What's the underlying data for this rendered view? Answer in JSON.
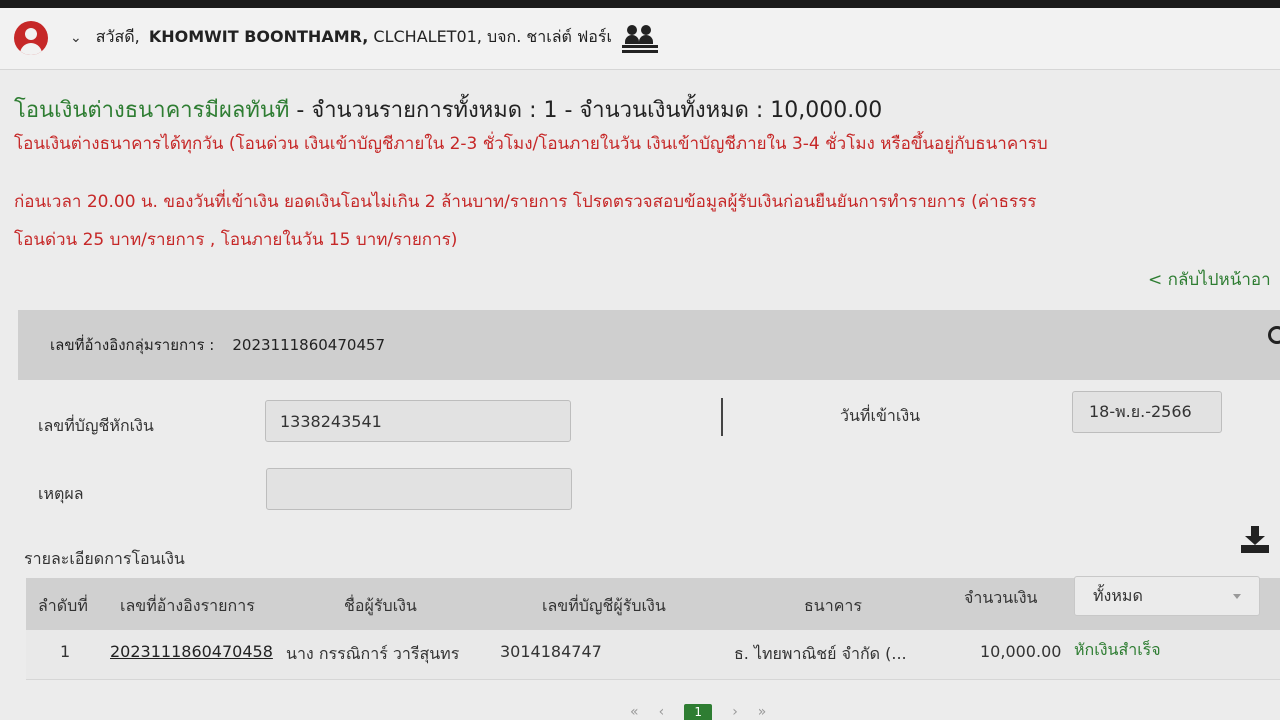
{
  "header": {
    "greeting_prefix": "สวัสดี,",
    "user_name": "KHOMWIT BOONTHAMR,",
    "company": "CLCHALET01, บจก. ชาเล่ต์ ฟอร์เ"
  },
  "page": {
    "title_main": "โอนเงินต่างธนาคารมีผลทันที",
    "title_rest": " - จำนวนรายการทั้งหมด : 1 - จำนวนเงินทั้งหมด : 10,000.00",
    "notice_line1": "โอนเงินต่างธนาคารได้ทุกวัน (โอนด่วน เงินเข้าบัญชีภายใน 2-3 ชั่วโมง/โอนภายในวัน เงินเข้าบัญชีภายใน 3-4 ชั่วโมง หรือขึ้นอยู่กับธนาคารบ",
    "notice_line2": "ก่อนเวลา 20.00 น. ของวันที่เข้าเงิน ยอดเงินโอนไม่เกิน 2 ล้านบาท/รายการ โปรดตรวจสอบข้อมูลผู้รับเงินก่อนยืนยันการทำรายการ (ค่าธรรร",
    "notice_line3": "โอนด่วน 25 บาท/รายการ , โอนภายในวัน 15 บาท/รายการ)",
    "back_label": "< กลับไปหน้าอา"
  },
  "group": {
    "label": "เลขที่อ้างอิงกลุ่มรายการ :",
    "value": "2023111860470457"
  },
  "form": {
    "debit_account_label": "เลขที่บัญชีหักเงิน",
    "debit_account_value": "1338243541",
    "effective_date_label": "วันที่เข้าเงิน",
    "effective_date_value": "18-พ.ย.-2566",
    "reason_label": "เหตุผล",
    "reason_value": ""
  },
  "details": {
    "section_label": "รายละเอียดการโอนเงิน",
    "columns": [
      "ลำดับที่",
      "เลขที่อ้างอิงรายการ",
      "ชื่อผู้รับเงิน",
      "เลขที่บัญชีผู้รับเงิน",
      "ธนาคาร",
      "จำนวนเงิน"
    ],
    "status_filter": "ทั้งหมด",
    "rows": [
      {
        "seq": "1",
        "ref": "2023111860470458",
        "payee": "นาง กรรณิการ์ วารีสุนทร",
        "account": "3014184747",
        "bank": "ธ. ไทยพาณิชย์ จำกัด (...",
        "amount": "10,000.00",
        "status": "หักเงินสำเร็จ"
      }
    ]
  },
  "pagination": {
    "current": "1"
  },
  "icons": {
    "user": "user-circle-icon",
    "dropdown": "chevron-down-icon",
    "switch": "switch-company-icon",
    "download": "download-icon"
  },
  "colors": {
    "brand_green": "#2e7d32",
    "warning_red": "#c62828"
  }
}
